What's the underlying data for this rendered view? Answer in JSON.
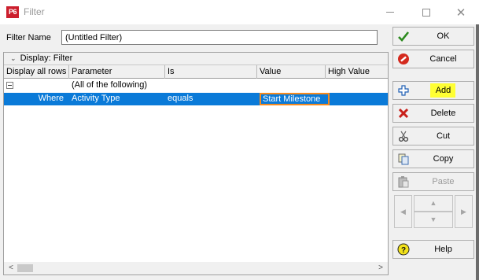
{
  "window": {
    "app_badge": "P6",
    "title": "Filter",
    "minimize_icon": "minimize-icon",
    "maximize_icon": "maximize-icon",
    "close_icon": "close-icon",
    "close_glyph": "✕"
  },
  "filter_name": {
    "label": "Filter Name",
    "value": "(Untitled Filter)"
  },
  "grid": {
    "display_label": "Display: Filter",
    "columns": [
      "Display all rows",
      "Parameter",
      "Is",
      "Value",
      "High Value"
    ],
    "rows": [
      {
        "display": "",
        "parameter": "(All of the following)",
        "is": "",
        "value": "",
        "high_value": ""
      },
      {
        "display": "Where",
        "parameter": "Activity Type",
        "is": "equals",
        "value": "Start Milestone",
        "high_value": ""
      }
    ],
    "scroll_left": "<",
    "scroll_right": ">"
  },
  "buttons": {
    "ok": "OK",
    "cancel": "Cancel",
    "add": "Add",
    "delete": "Delete",
    "cut": "Cut",
    "copy": "Copy",
    "paste": "Paste",
    "help": "Help"
  },
  "nav": {
    "left": "◀",
    "up": "▲",
    "down": "▼",
    "right": "▶"
  },
  "colors": {
    "selection": "#0a7ad8",
    "value_outline": "#f58a1f",
    "add_highlight": "#ffff33",
    "app_badge": "#cc1f2d"
  }
}
